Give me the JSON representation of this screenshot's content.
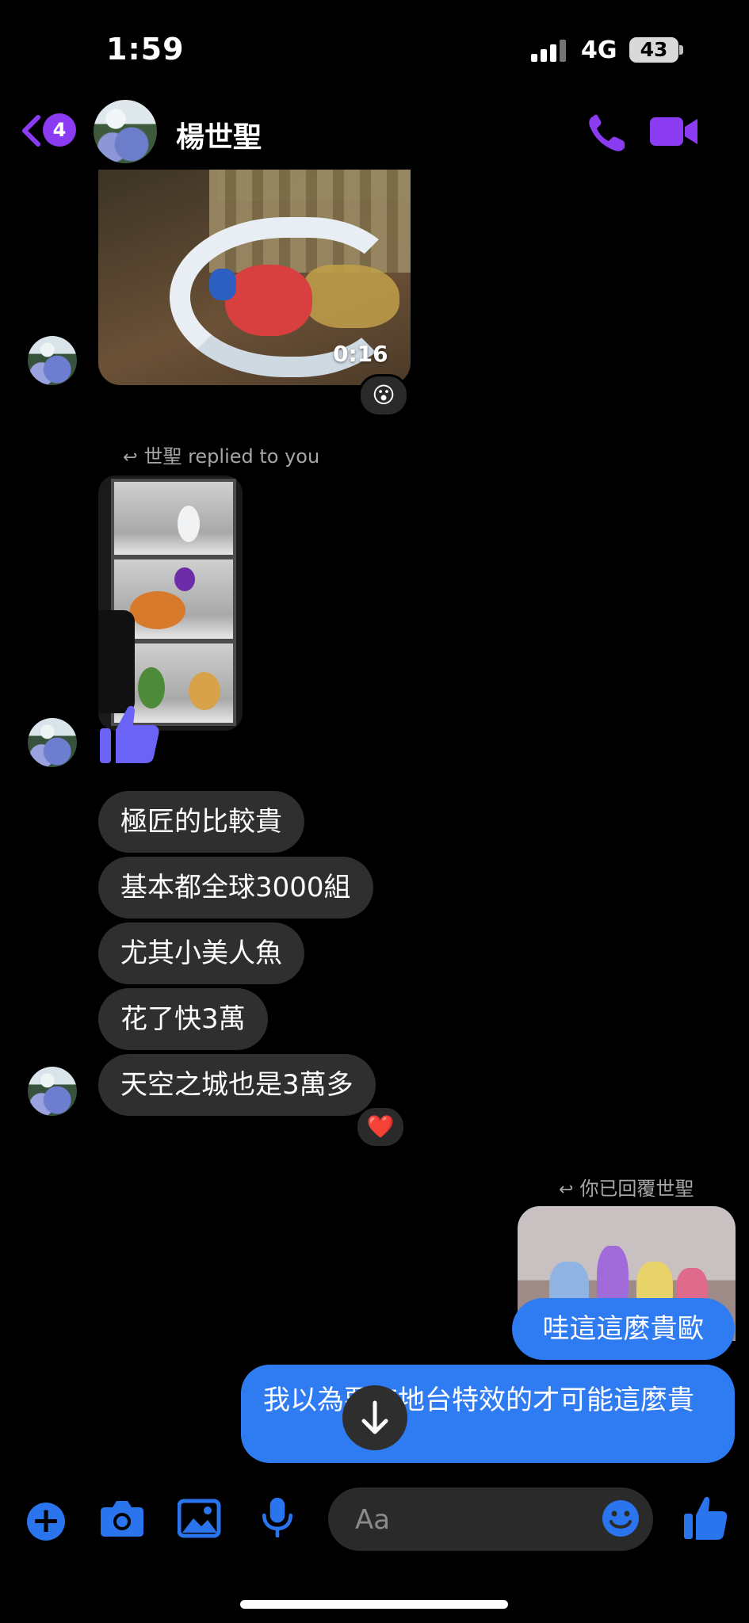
{
  "status_bar": {
    "time": "1:59",
    "network": "4G",
    "battery": "43"
  },
  "header": {
    "back_badge": "4",
    "contact_name": "楊世聖"
  },
  "messages": {
    "video_duration": "0:16",
    "video_reaction": "😮",
    "reply_label_in": "世聖 replied to you",
    "in_texts": [
      "極匠的比較貴",
      "基本都全球3000組",
      "尤其小美人魚",
      "花了快3萬",
      "天空之城也是3萬多"
    ],
    "last_in_reaction": "❤️",
    "reply_label_out": "你已回覆世聖",
    "out_texts": [
      "哇這這麼貴歐",
      "我以為要有地台特效的才可能這麼貴"
    ]
  },
  "composer": {
    "placeholder": "Aa"
  },
  "colors": {
    "accent_purple": "#8b3cf2",
    "accent_blue": "#2f7bf2",
    "bubble_in": "#2f2f2f"
  },
  "icons": [
    "back-chevron-icon",
    "phone-icon",
    "video-camera-icon",
    "plus-icon",
    "camera-icon",
    "gallery-icon",
    "microphone-icon",
    "emoji-icon",
    "thumbs-up-icon",
    "arrow-down-icon"
  ]
}
